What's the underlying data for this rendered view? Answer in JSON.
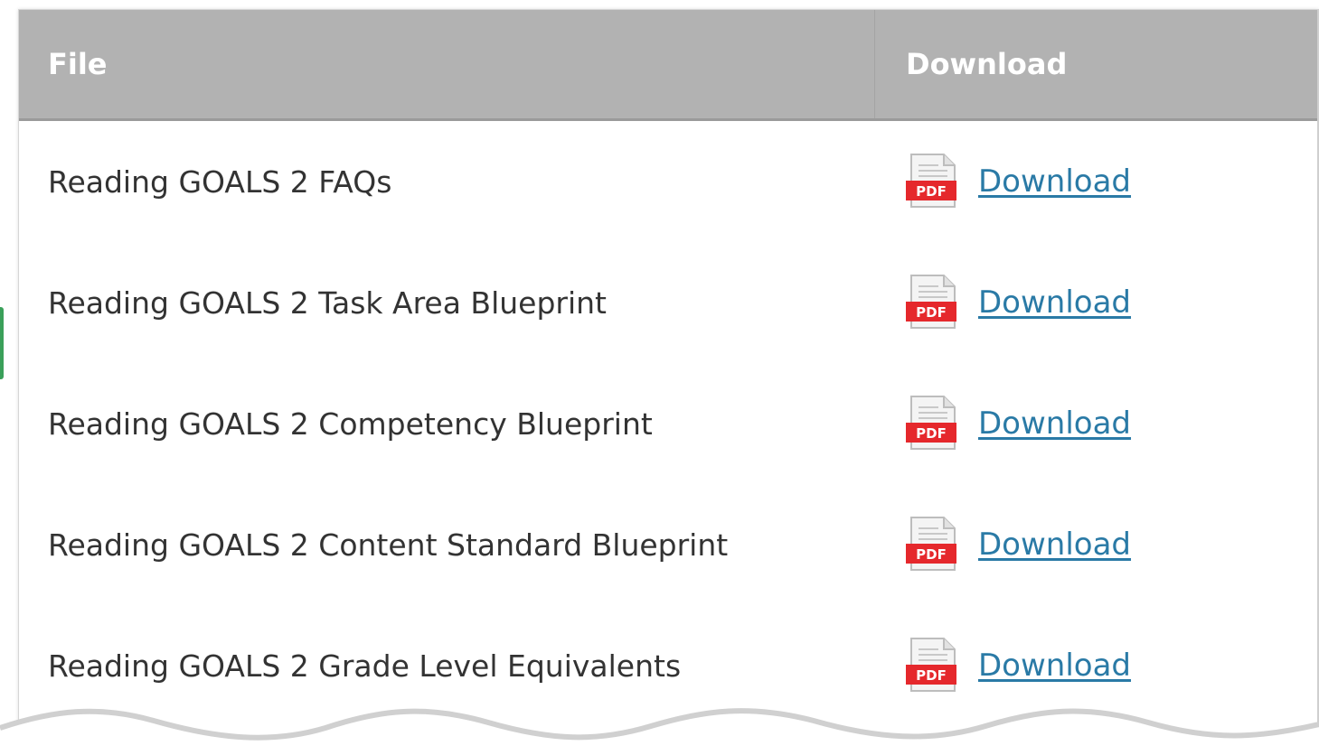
{
  "table": {
    "headers": {
      "file": "File",
      "download": "Download"
    },
    "icon": "pdf-file-icon",
    "icon_badge": "PDF",
    "rows": [
      {
        "file": "Reading GOALS 2 FAQs",
        "link": "Download"
      },
      {
        "file": "Reading GOALS 2 Task Area Blueprint",
        "link": "Download"
      },
      {
        "file": "Reading GOALS 2 Competency Blueprint",
        "link": "Download"
      },
      {
        "file": "Reading GOALS 2 Content Standard Blueprint",
        "link": "Download"
      },
      {
        "file": "Reading GOALS 2 Grade Level Equivalents",
        "link": "Download"
      }
    ]
  },
  "colors": {
    "header_bg": "#b2b2b2",
    "link": "#2a7aa6",
    "pdf_red": "#e5282c",
    "text": "#333333"
  }
}
